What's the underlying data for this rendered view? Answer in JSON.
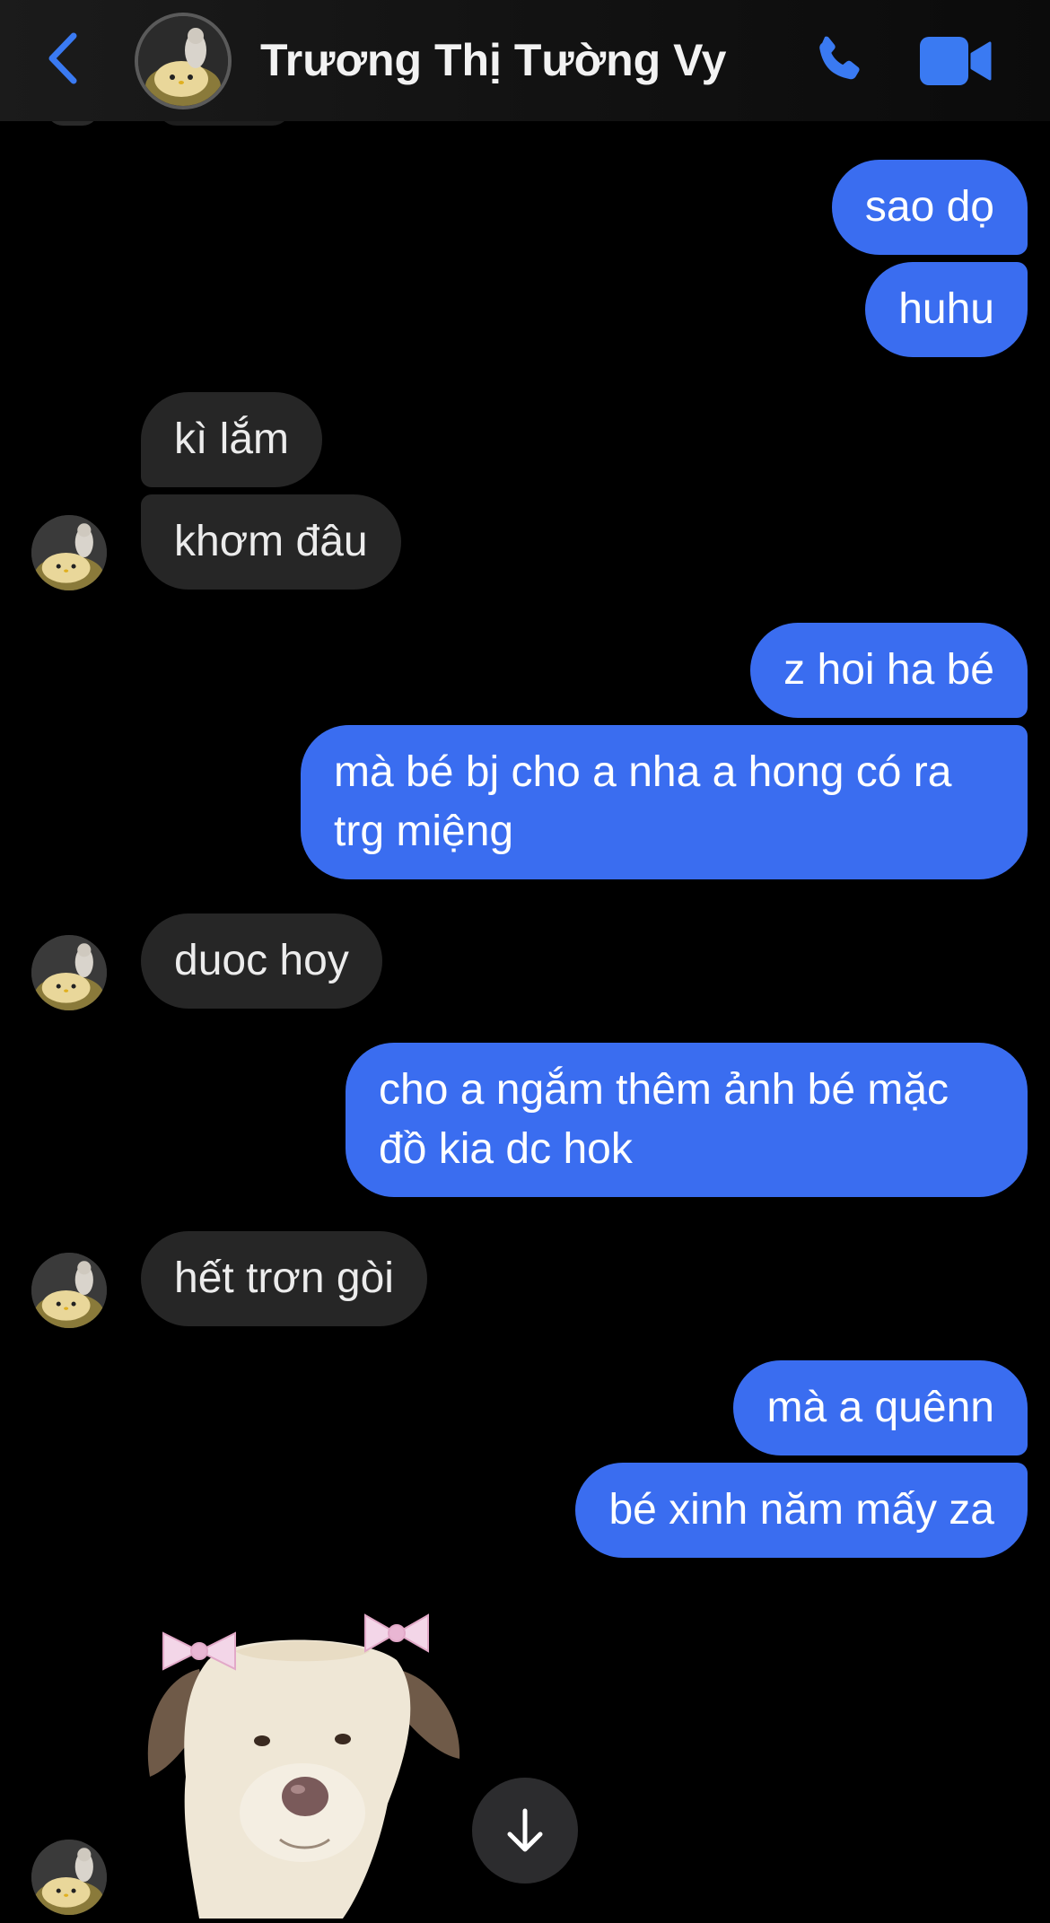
{
  "header": {
    "contact_name": "Trương Thị Tường Vy",
    "back_icon": "chevron-left-icon",
    "call_icon": "phone-icon",
    "video_icon": "video-camera-icon",
    "accent_color": "#3a6df0"
  },
  "messages": [
    {
      "from": "me",
      "text": "sao dọ"
    },
    {
      "from": "me",
      "text": "huhu"
    },
    {
      "from": "them",
      "text": "kì lắm"
    },
    {
      "from": "them",
      "text": "khơm đâu"
    },
    {
      "from": "me",
      "text": "z hoi ha bé"
    },
    {
      "from": "me",
      "text": "mà bé bj cho a nha a hong có ra trg miệng"
    },
    {
      "from": "them",
      "text": "duoc hoy"
    },
    {
      "from": "me",
      "text": "cho a ngắm thêm ảnh bé mặc đồ kia dc hok"
    },
    {
      "from": "them",
      "text": "hết trơn gòi"
    },
    {
      "from": "me",
      "text": "mà a quênn"
    },
    {
      "from": "me",
      "text": "bé xinh năm mấy za"
    },
    {
      "from": "them",
      "type": "sticker",
      "sticker": "dog-with-pink-bows"
    }
  ],
  "colors": {
    "sent_bubble": "#3a6df0",
    "received_bubble": "#262626",
    "background": "#000000"
  },
  "scroll_down_icon": "arrow-down-icon"
}
